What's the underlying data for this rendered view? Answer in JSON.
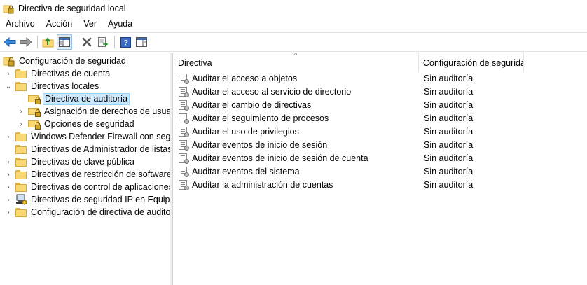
{
  "window": {
    "title": "Directiva de seguridad local",
    "app_icon": "security-policy-icon"
  },
  "menu": [
    "Archivo",
    "Acción",
    "Ver",
    "Ayuda"
  ],
  "toolbar": [
    {
      "icon": "back-arrow-icon",
      "active": false
    },
    {
      "icon": "forward-arrow-icon",
      "active": false
    },
    {
      "sep": true
    },
    {
      "icon": "up-folder-icon",
      "active": false
    },
    {
      "icon": "show-hide-tree-icon",
      "active": true
    },
    {
      "sep": true
    },
    {
      "icon": "delete-icon",
      "active": false
    },
    {
      "icon": "export-list-icon",
      "active": false
    },
    {
      "sep": true
    },
    {
      "icon": "help-icon",
      "active": false
    },
    {
      "icon": "properties-pane-icon",
      "active": false
    }
  ],
  "tree": [
    {
      "label": "Configuración de seguridad",
      "level": 0,
      "chevron": "",
      "icon": "security-settings-icon",
      "selected": false
    },
    {
      "label": "Directivas de cuenta",
      "level": 1,
      "chevron": "›",
      "icon": "folder-icon",
      "selected": false
    },
    {
      "label": "Directivas locales",
      "level": 1,
      "chevron": "⌄",
      "icon": "folder-icon",
      "selected": false
    },
    {
      "label": "Directiva de auditoría",
      "level": 2,
      "chevron": "",
      "icon": "locked-folder-icon",
      "selected": true
    },
    {
      "label": "Asignación de derechos de usuario",
      "level": 2,
      "chevron": "›",
      "icon": "locked-folder-icon",
      "selected": false
    },
    {
      "label": "Opciones de seguridad",
      "level": 2,
      "chevron": "›",
      "icon": "locked-folder-icon",
      "selected": false
    },
    {
      "label": "Windows Defender Firewall con seguridad avanzada",
      "level": 1,
      "chevron": "›",
      "icon": "folder-icon",
      "selected": false
    },
    {
      "label": "Directivas de Administrador de listas de redes",
      "level": 1,
      "chevron": "",
      "icon": "folder-icon",
      "selected": false
    },
    {
      "label": "Directivas de clave pública",
      "level": 1,
      "chevron": "›",
      "icon": "folder-icon",
      "selected": false
    },
    {
      "label": "Directivas de restricción de software",
      "level": 1,
      "chevron": "›",
      "icon": "folder-icon",
      "selected": false
    },
    {
      "label": "Directivas de control de aplicaciones",
      "level": 1,
      "chevron": "›",
      "icon": "folder-icon",
      "selected": false
    },
    {
      "label": "Directivas de seguridad IP en Equipo local",
      "level": 1,
      "chevron": "›",
      "icon": "ip-security-icon",
      "selected": false
    },
    {
      "label": "Configuración de directiva de auditoría avanzada",
      "level": 1,
      "chevron": "›",
      "icon": "folder-icon",
      "selected": false
    }
  ],
  "list": {
    "columns": [
      "Directiva",
      "Configuración de seguridad"
    ],
    "rows": [
      {
        "policy": "Auditar el acceso a objetos",
        "setting": "Sin auditoría"
      },
      {
        "policy": "Auditar el acceso al servicio de directorio",
        "setting": "Sin auditoría"
      },
      {
        "policy": "Auditar el cambio de directivas",
        "setting": "Sin auditoría"
      },
      {
        "policy": "Auditar el seguimiento de procesos",
        "setting": "Sin auditoría"
      },
      {
        "policy": "Auditar el uso de privilegios",
        "setting": "Sin auditoría"
      },
      {
        "policy": "Auditar eventos de inicio de sesión",
        "setting": "Sin auditoría"
      },
      {
        "policy": "Auditar eventos de inicio de sesión de cuenta",
        "setting": "Sin auditoría"
      },
      {
        "policy": "Auditar eventos del sistema",
        "setting": "Sin auditoría"
      },
      {
        "policy": "Auditar la administración de cuentas",
        "setting": "Sin auditoría"
      }
    ]
  },
  "colors": {
    "selection_bg": "#cce8ff",
    "selection_border": "#99d1ff",
    "folder_yellow": "#f8d775"
  }
}
